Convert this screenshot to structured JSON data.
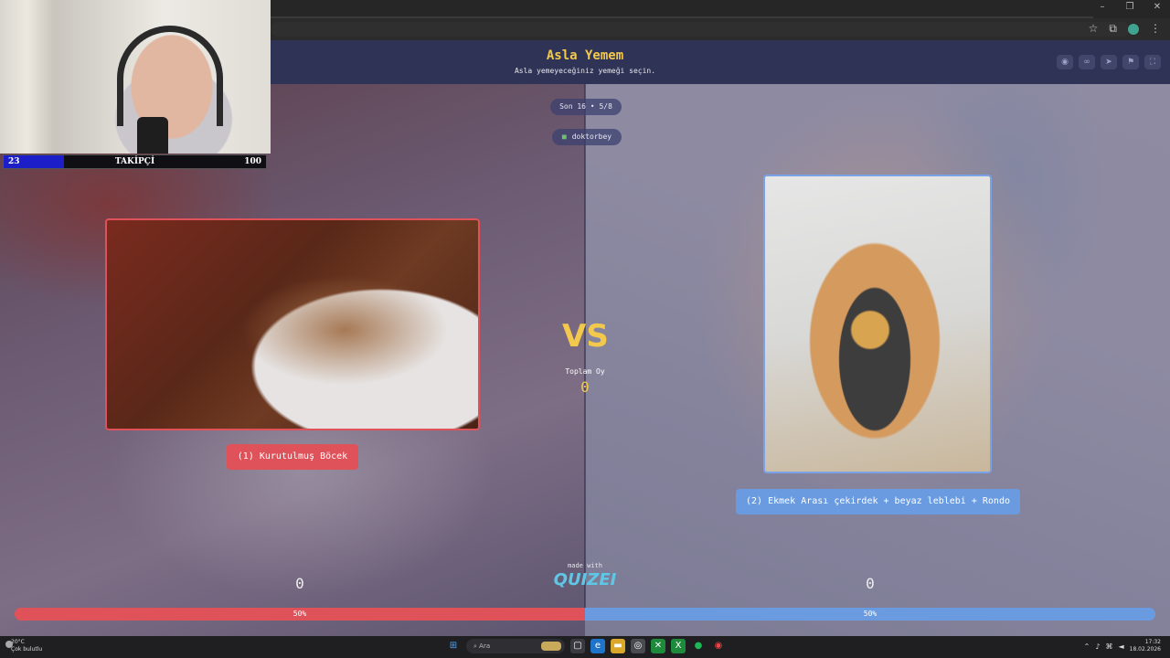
{
  "browser": {
    "window_controls": [
      "–",
      "❐",
      "✕"
    ],
    "toolbar_icons": [
      "star-icon",
      "extension-icon",
      "profile-avatar",
      "menu-icon"
    ]
  },
  "quiz": {
    "title": "Asla Yemem",
    "subtitle": "Asla yemeyeceğiniz yemeği seçin.",
    "round": "Son 16 • 5/8",
    "user": "doktorbey",
    "vs_text": "VS",
    "total_label": "Toplam Oy",
    "total_votes": "0",
    "left_option": {
      "label": "(1) Kurutulmuş Böcek",
      "votes": "0",
      "percent_text": "50%",
      "percent": 50
    },
    "right_option": {
      "label": "(2) Ekmek Arası çekirdek + beyaz leblebi + Rondo",
      "votes": "0",
      "percent_text": "50%",
      "percent": 50
    },
    "made_with": "made with",
    "brand": "QUIZEI",
    "colors": {
      "accent": "#f2c94c",
      "left": "#e0525a",
      "right": "#6a9be0",
      "header": "#2f3355"
    }
  },
  "overlay": {
    "follower_current": "23",
    "follower_label": "TAKİPÇİ",
    "follower_goal": "100",
    "follower_progress": 0.23
  },
  "taskbar": {
    "weather_temp": "20°C",
    "weather_desc": "Çok bulutlu",
    "search_placeholder": "Ara",
    "time": "17:32",
    "date": "18.02.2026"
  }
}
